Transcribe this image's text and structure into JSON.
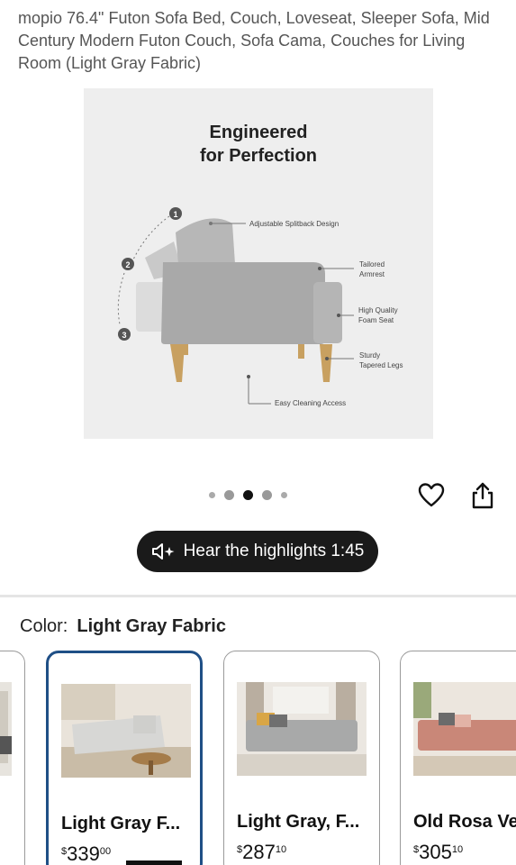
{
  "product": {
    "title": "mopio 76.4\" Futon Sofa Bed, Couch, Loveseat, Sleeper Sofa, Mid Century Modern Futon Couch, Sofa Cama, Couches for Living Room (Light Gray Fabric)"
  },
  "image": {
    "headline_line1": "Engineered",
    "headline_line2": "for Perfection",
    "callouts": {
      "splitback": "Adjustable Splitback Design",
      "armrest_1": "Tailored",
      "armrest_2": "Armrest",
      "foam_1": "High Quality",
      "foam_2": "Foam Seat",
      "legs_1": "Sturdy",
      "legs_2": "Tapered Legs",
      "cleaning": "Easy Cleaning Access"
    },
    "steps": [
      "1",
      "2",
      "3"
    ]
  },
  "carousel": {
    "total": 5,
    "active_index": 2
  },
  "actions": {
    "wishlist_icon": "heart-outline-icon",
    "share_icon": "share-icon",
    "hear_highlights_label": "Hear the highlights 1:45",
    "hear_icon": "speaker-sparkle-icon"
  },
  "color": {
    "label": "Color:",
    "selected": "Light Gray Fabric"
  },
  "variants": [
    {
      "name": "Light Gray F...",
      "price_currency": "$",
      "price_whole": "339",
      "price_cents": "00",
      "selected": true
    },
    {
      "name": "Light Gray, F...",
      "price_currency": "$",
      "price_whole": "287",
      "price_cents": "10",
      "selected": false
    },
    {
      "name": "Old Rosa Ve",
      "price_currency": "$",
      "price_whole": "305",
      "price_cents": "10",
      "selected": false
    }
  ],
  "colors": {
    "selected_border": "#1f4f86",
    "button_bg": "#1a1a1a",
    "image_bg": "#eeeeee"
  }
}
